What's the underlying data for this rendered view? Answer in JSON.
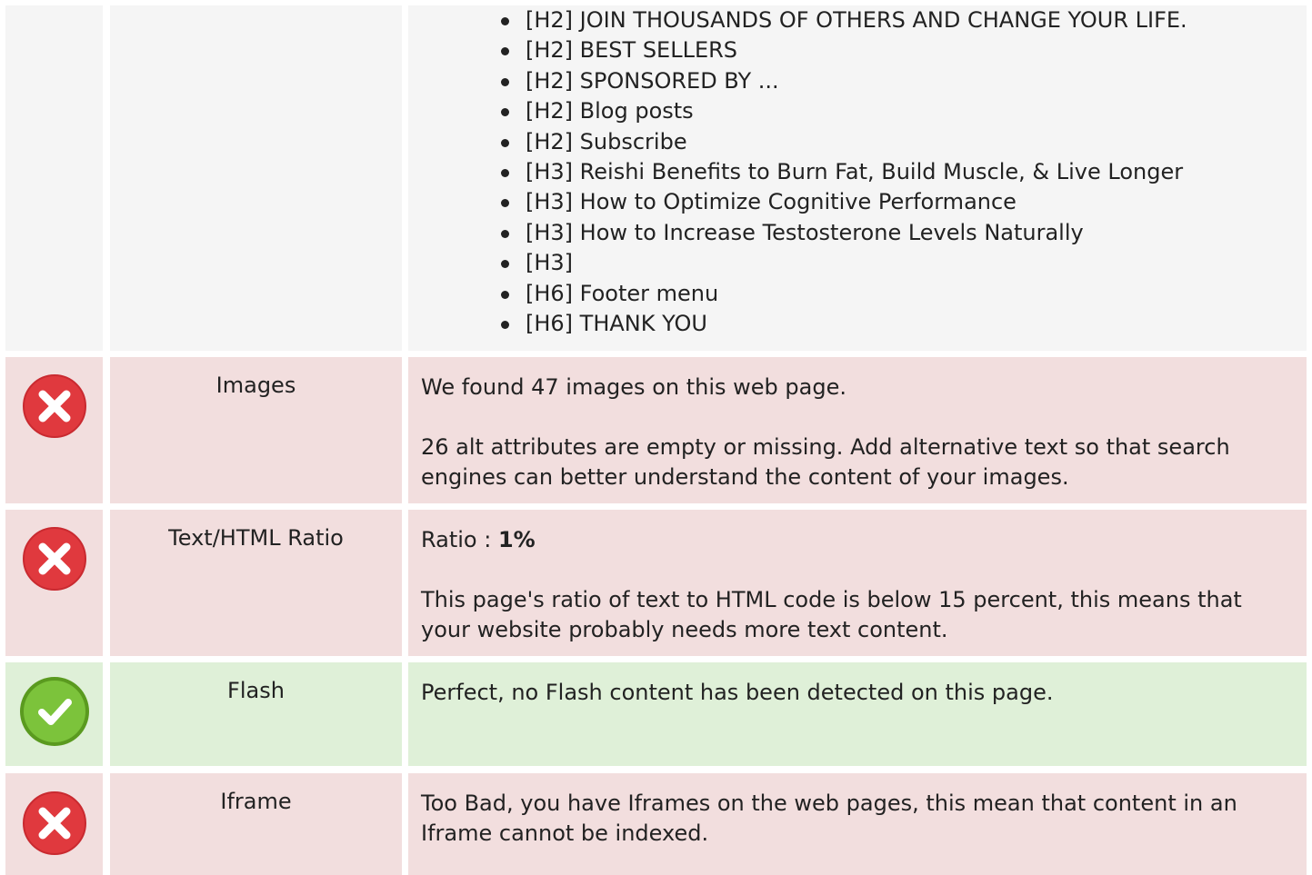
{
  "headings_list": [
    "[H2] JOIN THOUSANDS OF OTHERS AND CHANGE YOUR LIFE.",
    "[H2] BEST SELLERS",
    "[H2] SPONSORED BY ...",
    "[H2] Blog posts",
    "[H2] Subscribe",
    "[H3] Reishi Benefits to Burn Fat, Build Muscle, & Live Longer",
    "[H3] How to Optimize Cognitive Performance",
    "[H3] How to Increase Testosterone Levels Naturally",
    "[H3]",
    "[H6] Footer menu",
    "[H6] THANK YOU"
  ],
  "rows": {
    "images": {
      "status": "error",
      "icon": "error-x-icon",
      "label": "Images",
      "line1": "We found 47 images on this web page.",
      "line2": "26 alt attributes are empty or missing. Add alternative text so that search engines can better understand the content of your images."
    },
    "ratio": {
      "status": "error",
      "icon": "error-x-icon",
      "label": "Text/HTML Ratio",
      "ratio_prefix": "Ratio : ",
      "ratio_value": "1%",
      "line2": "This page's ratio of text to HTML code is below 15 percent, this means that your website probably needs more text content."
    },
    "flash": {
      "status": "ok",
      "icon": "check-icon",
      "label": "Flash",
      "line1": "Perfect, no Flash content has been detected on this page."
    },
    "iframe": {
      "status": "error",
      "icon": "error-x-icon",
      "label": "Iframe",
      "line1": "Too Bad, you have Iframes on the web pages, this mean that content in an Iframe cannot be indexed."
    }
  },
  "colors": {
    "error_bg": "#f2dede",
    "ok_bg": "#dff0d8",
    "neutral_bg": "#f5f5f5",
    "error_icon": "#e0393e",
    "ok_icon": "#7cc33b"
  }
}
